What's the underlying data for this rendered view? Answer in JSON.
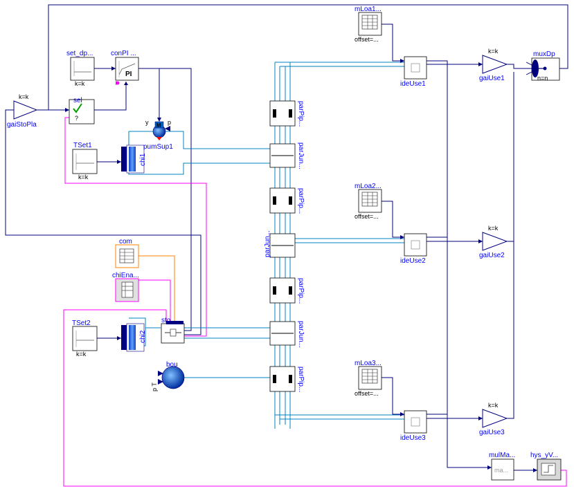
{
  "blocks": {
    "mLoa1": {
      "name": "mLoa1...",
      "param": "offset=..."
    },
    "mLoa2": {
      "name": "mLoa2...",
      "param": "offset=..."
    },
    "mLoa3": {
      "name": "mLoa3...",
      "param": "offset=..."
    },
    "muxDp": {
      "name": "muxDp",
      "param": "n=n"
    },
    "gaiUse1": {
      "name": "gaiUse1",
      "param": "k=k"
    },
    "gaiUse2": {
      "name": "gaiUse2",
      "param": "k=k"
    },
    "gaiUse3": {
      "name": "gaiUse3",
      "param": "k=k"
    },
    "ideUse1": {
      "name": "ideUse1"
    },
    "ideUse2": {
      "name": "ideUse2"
    },
    "ideUse3": {
      "name": "ideUse3"
    },
    "set_dp": {
      "name": "set_dp...",
      "param": "k=k"
    },
    "conPI": {
      "name": "conPI ...",
      "inner": "PI"
    },
    "sel": {
      "name": "sel",
      "inner": "?"
    },
    "gaiStoPla": {
      "name": "gaiStoPla",
      "param": "k=k"
    },
    "TSet1": {
      "name": "TSet1",
      "param": "k=k"
    },
    "TSet2": {
      "name": "TSet2",
      "param": "k=k"
    },
    "chi1": {
      "name": "chi1"
    },
    "chi2": {
      "name": "chi2"
    },
    "pumSup1": {
      "name": "pumSup1",
      "port_y": "y",
      "port_p": "p",
      "inner": "M"
    },
    "com": {
      "name": "com"
    },
    "chiEna": {
      "name": "chiEna..."
    },
    "sto": {
      "name": "sto"
    },
    "bou": {
      "name": "bou",
      "ports": "p T"
    },
    "parPip1": {
      "name": "parPip..."
    },
    "parJun1": {
      "name": "parJun..."
    },
    "parPip2": {
      "name": "parPip..."
    },
    "parJun2": {
      "name": "parJun..."
    },
    "parPip3": {
      "name": "parPip..."
    },
    "parJun3": {
      "name": "parJun..."
    },
    "parPip4": {
      "name": "parPip..."
    },
    "mulMax": {
      "name": "mulMa...",
      "inner": "ma..."
    },
    "hys": {
      "name": "hys_yV..."
    }
  },
  "colors": {
    "signal": "#00007f",
    "fluid": "#0080c0",
    "boolean": "#ff00ff",
    "integer": "#ff8000",
    "label": "#0000ff"
  }
}
